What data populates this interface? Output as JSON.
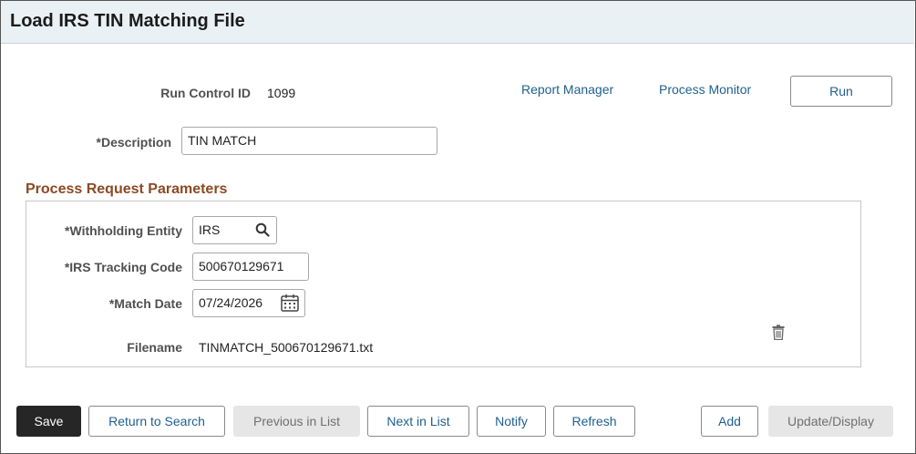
{
  "page": {
    "title": "Load IRS TIN Matching File"
  },
  "run_control": {
    "label": "Run Control ID",
    "value": "1099"
  },
  "links": {
    "report_manager": "Report Manager",
    "process_monitor": "Process Monitor"
  },
  "run_button": "Run",
  "description": {
    "label": "*Description",
    "value": "TIN MATCH"
  },
  "params": {
    "title": "Process Request Parameters",
    "withholding_entity": {
      "label": "*Withholding Entity",
      "value": "IRS"
    },
    "irs_tracking_code": {
      "label": "*IRS Tracking Code",
      "value": "500670129671"
    },
    "match_date": {
      "label": "*Match Date",
      "value": "07/24/2026"
    },
    "filename": {
      "label": "Filename",
      "value": "TINMATCH_500670129671.txt"
    }
  },
  "icons": {
    "lookup": "search-icon",
    "calendar": "calendar-icon",
    "delete": "trash-icon"
  },
  "toolbar": {
    "save": "Save",
    "return_to_search": "Return to Search",
    "previous_in_list": "Previous in List",
    "next_in_list": "Next in List",
    "notify": "Notify",
    "refresh": "Refresh",
    "add": "Add",
    "update_display": "Update/Display"
  },
  "colors": {
    "section_title": "#8b4a24",
    "link": "#1e5f8f",
    "header_bg": "#eaf1f5",
    "primary_button": "#262626"
  }
}
